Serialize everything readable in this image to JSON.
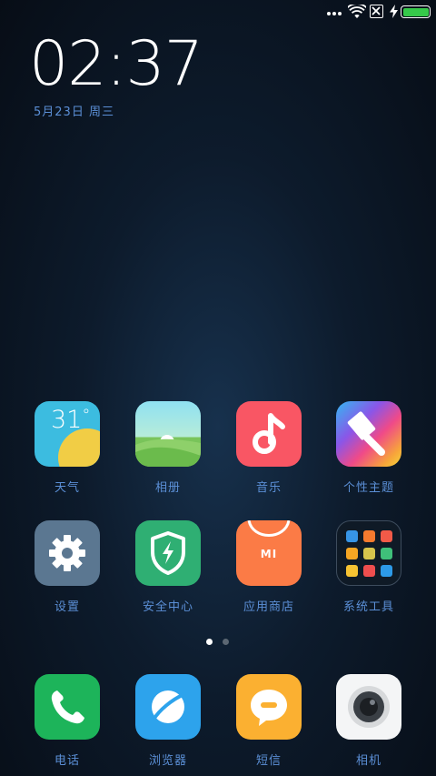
{
  "status_bar": {
    "icons": [
      "more-dots-icon",
      "wifi-icon",
      "no-sim-icon",
      "charging-icon",
      "battery-icon"
    ],
    "battery_color": "#36c94a",
    "battery_level": 1.0
  },
  "lockscreen": {
    "time": "02:37",
    "date": "5月23日 周三"
  },
  "apps": [
    {
      "label": "天气",
      "icon": "weather-icon",
      "temp": "31",
      "deg": "°",
      "color": "#3cbce0"
    },
    {
      "label": "相册",
      "icon": "gallery-icon",
      "color": "#8fe1f2"
    },
    {
      "label": "音乐",
      "icon": "music-note-icon",
      "color": "#f95664"
    },
    {
      "label": "个性主题",
      "icon": "paint-brush-icon",
      "color": "#8a56e8"
    },
    {
      "label": "设置",
      "icon": "gear-icon",
      "color": "#5b7791"
    },
    {
      "label": "安全中心",
      "icon": "shield-bolt-icon",
      "color": "#2faf73"
    },
    {
      "label": "应用商店",
      "icon": "shopping-bag-icon",
      "mark": "MI",
      "color": "#fb7b46"
    },
    {
      "label": "系统工具",
      "icon": "folder-icon",
      "color": "#0f1a26"
    }
  ],
  "pager": {
    "count": 2,
    "active": 1
  },
  "dock": [
    {
      "label": "电话",
      "icon": "phone-icon",
      "color": "#1db45a"
    },
    {
      "label": "浏览器",
      "icon": "browser-icon",
      "color": "#2da3ec"
    },
    {
      "label": "短信",
      "icon": "message-icon",
      "color": "#fbb031"
    },
    {
      "label": "相机",
      "icon": "camera-icon",
      "color": "#f4f5f6"
    }
  ]
}
